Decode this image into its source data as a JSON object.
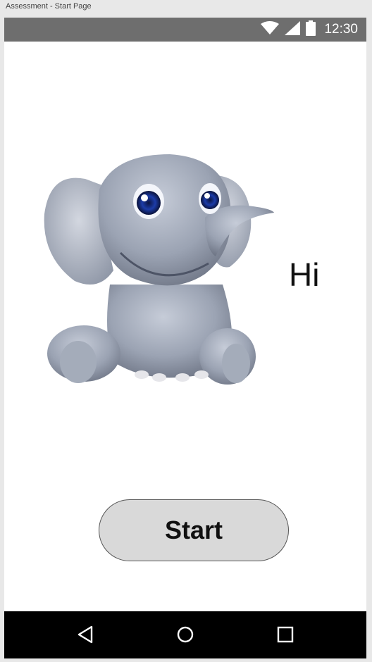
{
  "window": {
    "title": "Assessment -  Start Page"
  },
  "status_bar": {
    "time": "12:30",
    "icons": [
      "wifi-icon",
      "signal-icon",
      "battery-icon"
    ],
    "background": "#6e6e6e"
  },
  "main": {
    "greeting": "Hi",
    "image": "baby-elephant-illustration",
    "start_button_label": "Start",
    "button_background": "#d9d9d9"
  },
  "nav_bar": {
    "buttons": [
      "back-icon",
      "home-icon",
      "recents-icon"
    ],
    "background": "#000000"
  }
}
